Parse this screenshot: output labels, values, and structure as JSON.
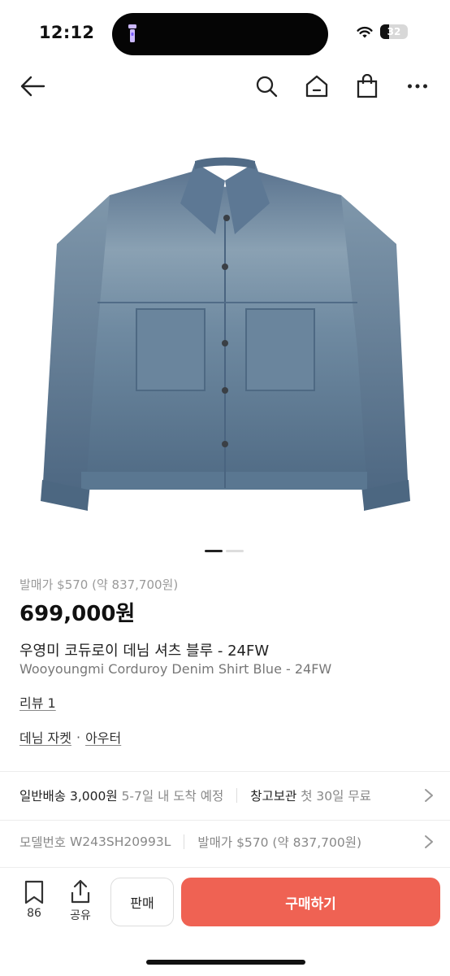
{
  "status_bar": {
    "time": "12:12",
    "battery_text": "32",
    "battery_level": 0.32
  },
  "nav": {
    "back_icon": "arrow-left-icon",
    "search_icon": "search-icon",
    "home_icon": "home-icon",
    "cart_icon": "shopping-bag-icon",
    "more_icon": "more-horizontal-icon"
  },
  "gallery": {
    "image_count": 2,
    "current_index": 1
  },
  "product": {
    "release_price": "발매가 $570 (약 837,700원)",
    "price": "699,000원",
    "name_ko": "우영미 코듀로이 데님 셔츠 블루 - 24FW",
    "name_en": "Wooyoungmi Corduroy Denim Shirt Blue - 24FW",
    "review_link": "리뷰 1",
    "category_1": "데님 자켓",
    "category_separator": "·",
    "category_2": "아우터"
  },
  "shipping_row": {
    "label": "일반배송",
    "fee": "3,000원",
    "eta": "5-7일 내 도착 예정",
    "storage_label": "창고보관",
    "storage_note": "첫 30일 무료"
  },
  "model_row": {
    "label": "모델번호",
    "model_number": "W243SH20993L",
    "release_label": "발매가",
    "release_value": "$570 (약 837,700원)"
  },
  "bottom_bar": {
    "bookmark_count": "86",
    "share_label": "공유",
    "sell_label": "판매",
    "buy_label": "구매하기",
    "buy_color": "#ef6253"
  }
}
